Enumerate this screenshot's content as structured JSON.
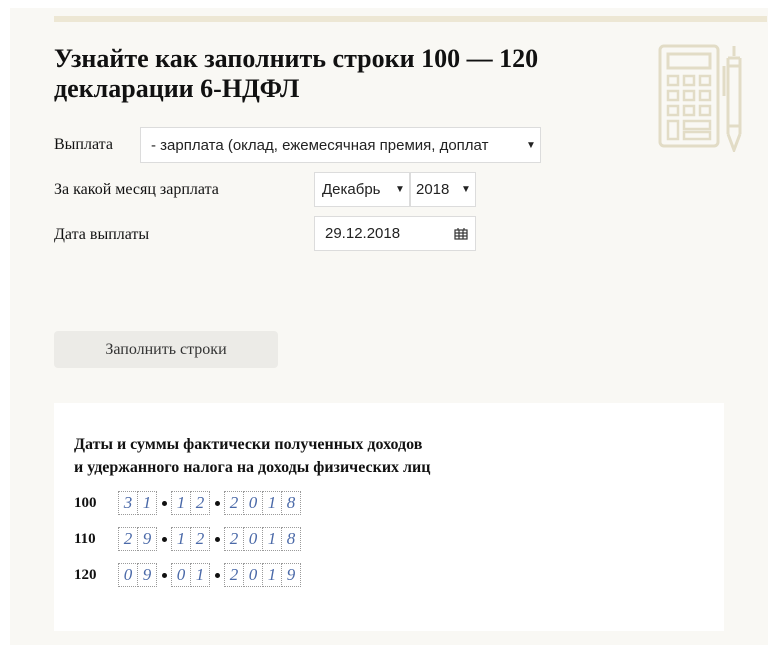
{
  "header": {
    "title": "Узнайте как заполнить строки 100 — 120 декларации 6-НДФЛ"
  },
  "form": {
    "payment_label": "Выплата",
    "payment_value": "- зарплата (оклад, ежемесячная премия, доплат",
    "month_label": "За какой месяц зарплата",
    "month_value": "Декабрь",
    "year_value": "2018",
    "date_label": "Дата выплаты",
    "date_value": "29.12.2018",
    "submit_label": "Заполнить строки"
  },
  "result": {
    "title_line1": "Даты и суммы фактически полученных доходов",
    "title_line2": "и удержанного налога на доходы физических лиц",
    "rows": [
      {
        "num": "100",
        "digits": [
          "3",
          "1",
          "1",
          "2",
          "2",
          "0",
          "1",
          "8"
        ]
      },
      {
        "num": "110",
        "digits": [
          "2",
          "9",
          "1",
          "2",
          "2",
          "0",
          "1",
          "8"
        ]
      },
      {
        "num": "120",
        "digits": [
          "0",
          "9",
          "0",
          "1",
          "2",
          "0",
          "1",
          "9"
        ]
      }
    ]
  },
  "icons": {
    "decoration": "calculator-pen-icon",
    "date_picker": "calendar-icon"
  },
  "colors": {
    "background": "#f9f8f4",
    "accent_bar": "#ede7d4",
    "digit_color": "#4a69a8",
    "button_bg": "#ecebe7"
  }
}
